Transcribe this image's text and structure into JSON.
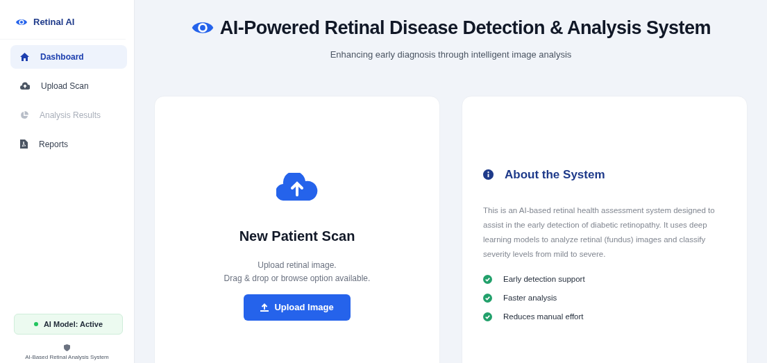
{
  "sidebar": {
    "brand": "Retinal AI",
    "items": [
      {
        "label": "Dashboard",
        "selected": true,
        "disabled": false
      },
      {
        "label": "Upload Scan",
        "selected": false,
        "disabled": false
      },
      {
        "label": "Analysis Results",
        "selected": false,
        "disabled": true
      },
      {
        "label": "Reports",
        "selected": false,
        "disabled": false
      }
    ],
    "status": {
      "label": "AI Model: Active",
      "on": true
    },
    "footer": "AI-Based Retinal Analysis System"
  },
  "header": {
    "title": "AI-Powered Retinal Disease Detection & Analysis System",
    "subtitle": "Enhancing early diagnosis through intelligent image analysis"
  },
  "upload_card": {
    "title": "New Patient Scan",
    "lines": [
      "Upload retinal image.",
      "Drag & drop or browse option available."
    ],
    "button": "Upload Image"
  },
  "about_card": {
    "title": "About the System",
    "text": "This is an AI-based retinal health assessment system designed to assist in the early detection of diabetic retinopathy. It uses deep learning models to analyze retinal (fundus) images and classify severity levels from mild to severe.",
    "features": [
      {
        "label": "Early detection support",
        "checked": true
      },
      {
        "label": "Faster analysis",
        "checked": true
      },
      {
        "label": "Reduces manual effort",
        "checked": true
      }
    ]
  }
}
